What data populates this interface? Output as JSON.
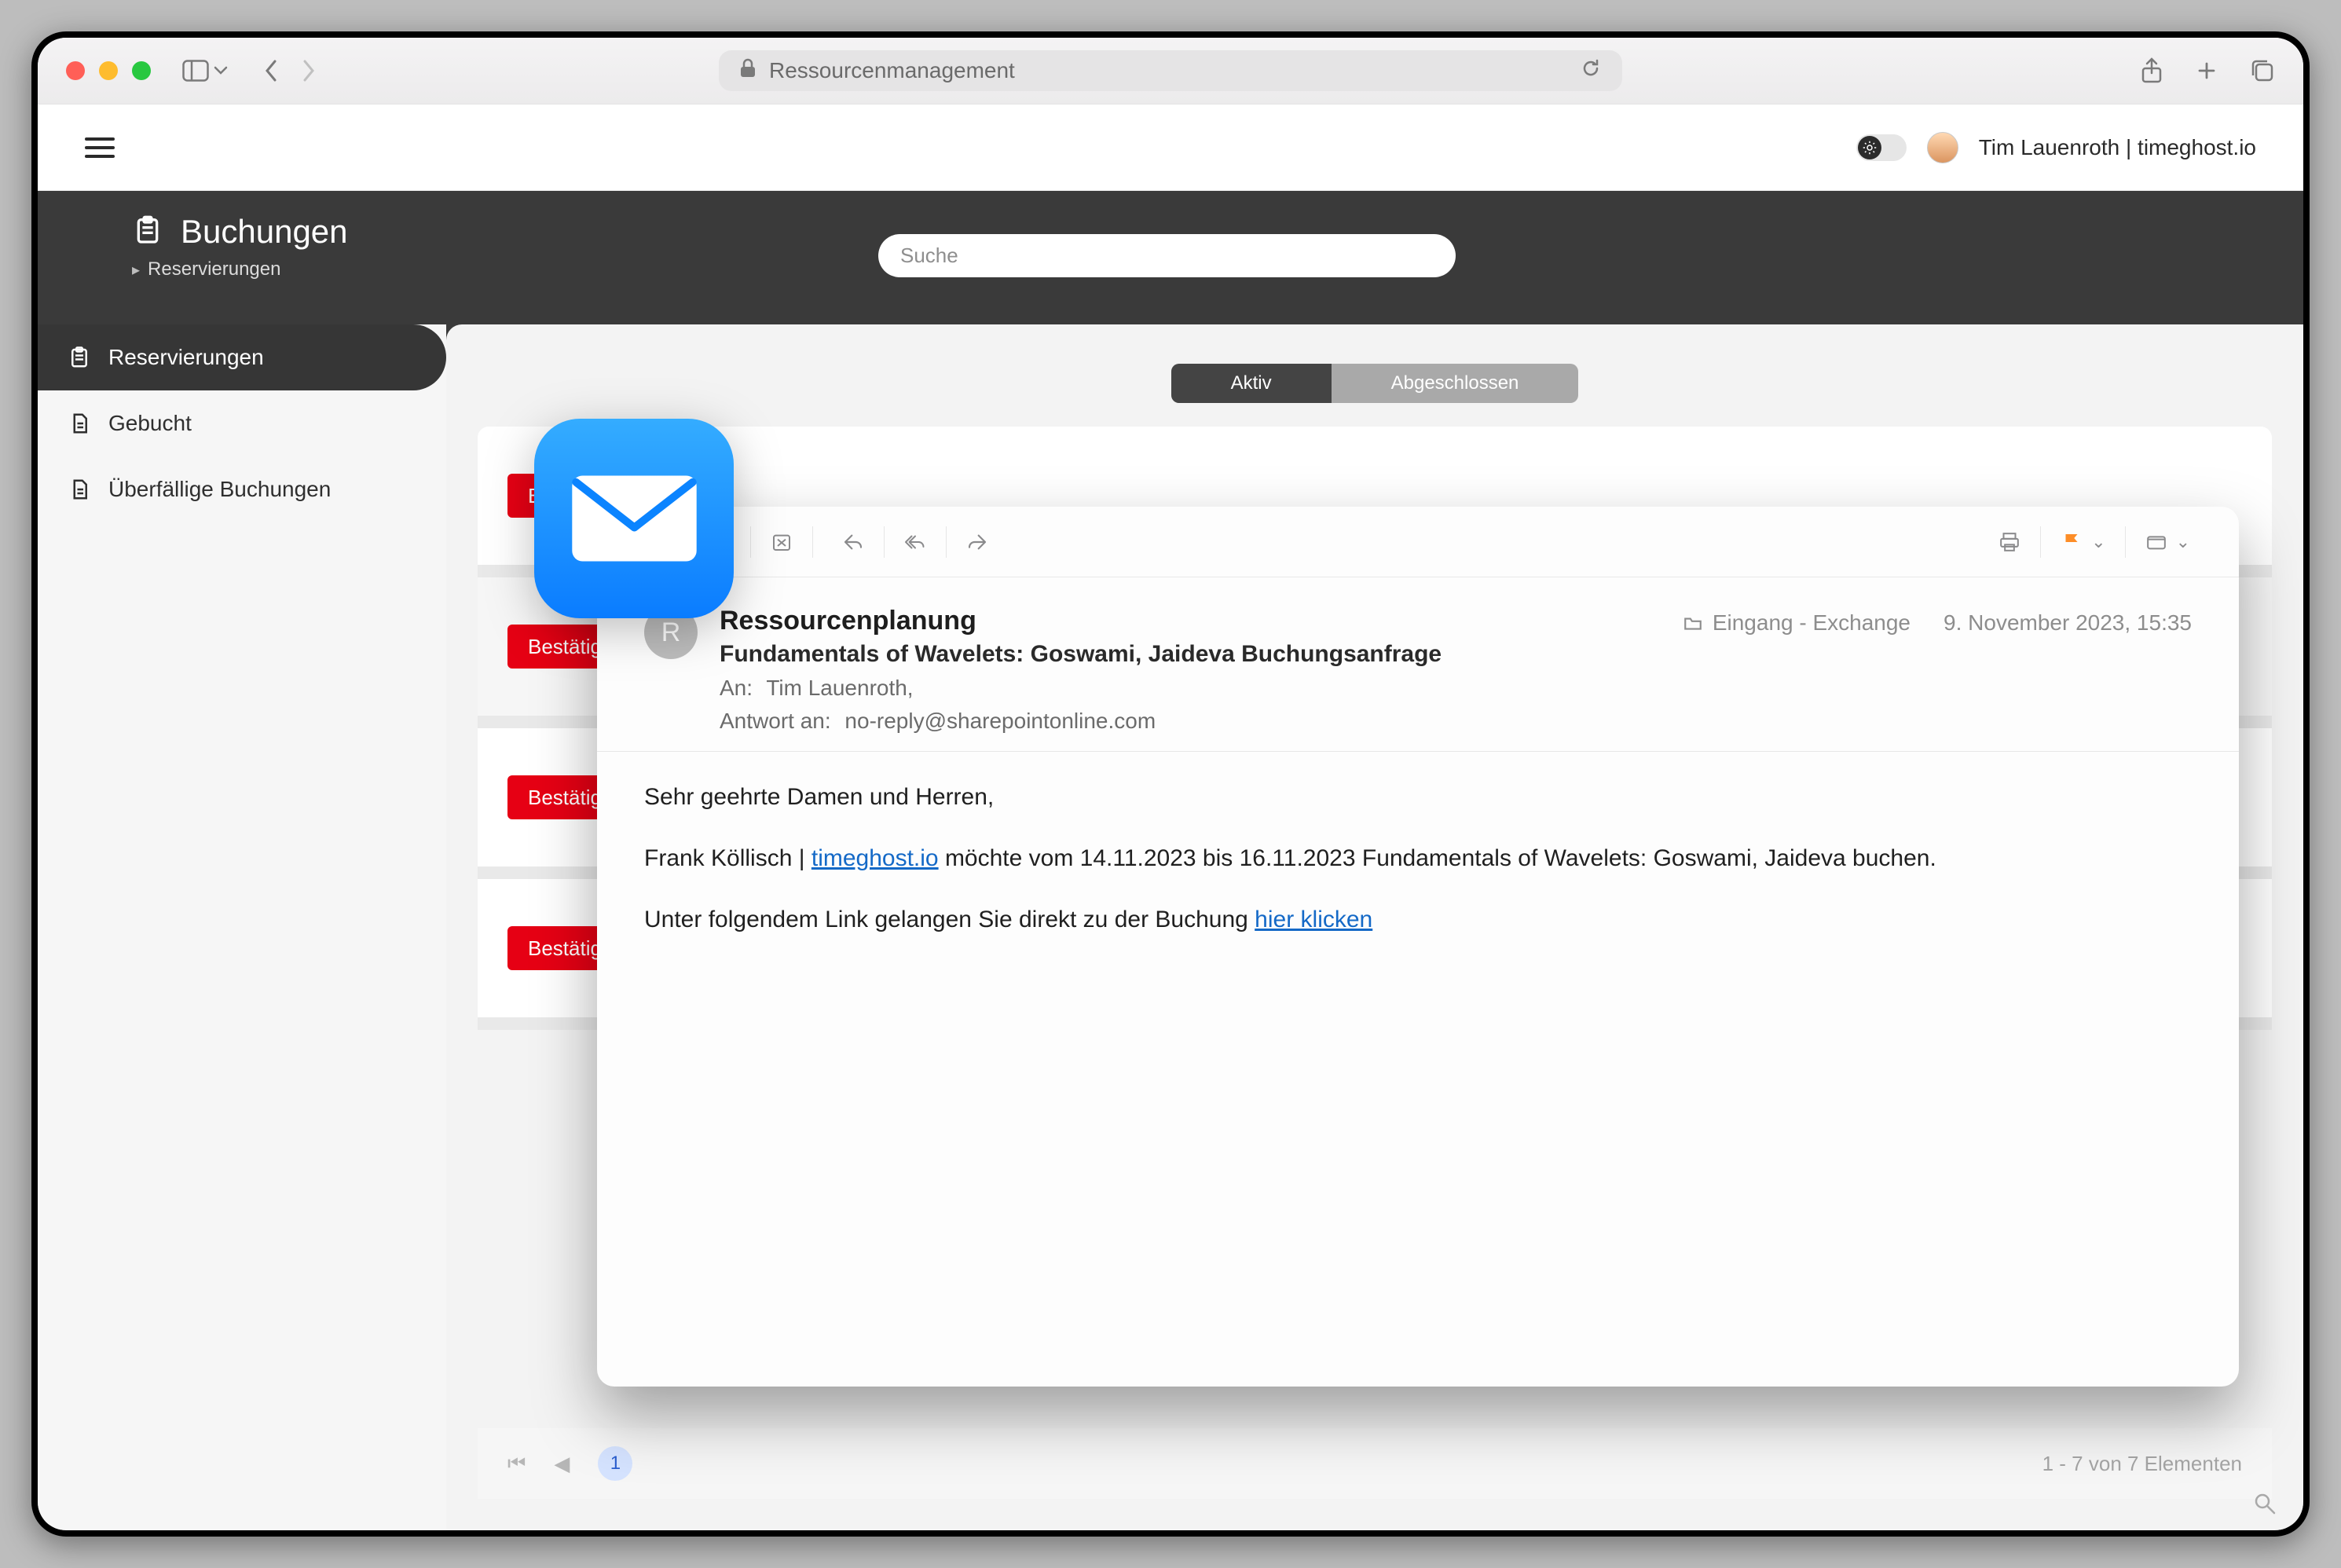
{
  "browser": {
    "url_label": "Ressourcenmanagement"
  },
  "app_top": {
    "user_label": "Tim Lauenroth | timeghost.io"
  },
  "dark_header": {
    "title": "Buchungen",
    "breadcrumb": "Reservierungen",
    "search_placeholder": "Suche"
  },
  "sidebar": {
    "items": [
      {
        "label": "Reservierungen"
      },
      {
        "label": "Gebucht"
      },
      {
        "label": "Überfällige Buchungen"
      }
    ]
  },
  "segmented": {
    "active": "Aktiv",
    "done": "Abgeschlossen"
  },
  "rows": {
    "confirm_label": "Bestätigen"
  },
  "pager": {
    "current": "1",
    "count_label": "1 - 7 von 7 Elementen"
  },
  "mail": {
    "sender_initial": "R",
    "from": "Ressourcenplanung",
    "subject": "Fundamentals of Wavelets: Goswami, Jaideva Buchungsanfrage",
    "to_label": "An:",
    "to_value": "Tim Lauenroth,",
    "reply_to_label": "Antwort an:",
    "reply_to_value": "no-reply@sharepointonline.com",
    "folder": "Eingang - Exchange",
    "date": "9. November 2023, 15:35",
    "body_line1": "Sehr geehrte Damen und Herren,",
    "body_line2_prefix": "Frank Köllisch | ",
    "body_line2_link": "timeghost.io",
    "body_line2_suffix": " möchte vom 14.11.2023 bis 16.11.2023 Fundamentals of Wavelets: Goswami, Jaideva buchen.",
    "body_line3_prefix": "Unter folgendem Link gelangen Sie direkt zu der Buchung ",
    "body_line3_link": "hier klicken"
  }
}
